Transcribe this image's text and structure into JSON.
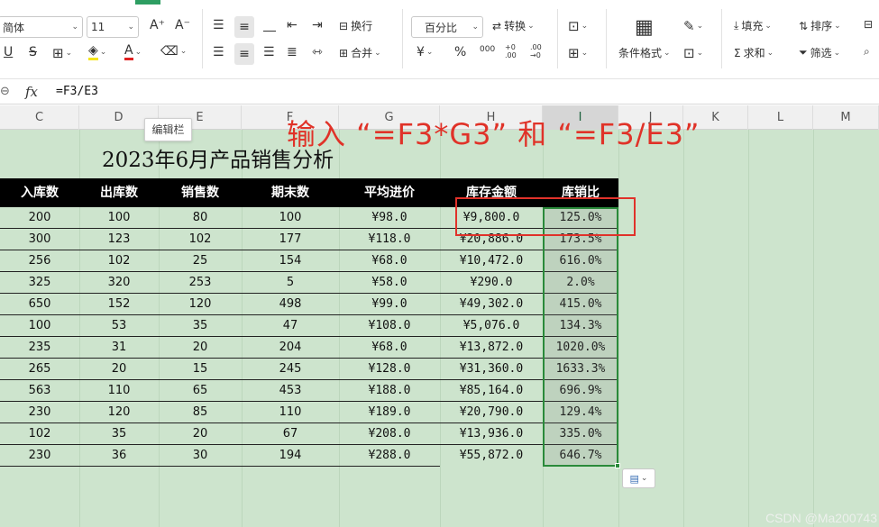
{
  "ribbon": {
    "font_name": "简体",
    "font_size": "11",
    "number_format": "百分比",
    "wrap_label": "换行",
    "merge_label": "合并",
    "convert_label": "转换",
    "cond_format_label": "条件格式",
    "fill_label": "填充",
    "sort_label": "排序",
    "sum_label": "求和",
    "filter_label": "筛选",
    "currency_symbol": "¥",
    "percent_symbol": "%",
    "thousands_symbol": "000",
    "dec_increase": "+0 .00",
    "dec_decrease": ".00 →0",
    "bold_u": "U",
    "strike_s": "S",
    "font_grow": "A⁺",
    "font_shrink": "A⁻",
    "font_color_letter": "A"
  },
  "formula_bar": {
    "formula": "=F3/E3",
    "fx": "fx"
  },
  "columns": [
    "C",
    "D",
    "E",
    "F",
    "G",
    "H",
    "I",
    "J",
    "K",
    "L",
    "M"
  ],
  "tooltip": "编辑栏",
  "annotation": "输入  “=F3*G3” 和 “=F3/E3”",
  "sheet": {
    "title": "2023年6月产品销售分析",
    "headers": [
      "入库数",
      "出库数",
      "销售数",
      "期末数",
      "平均进价",
      "库存金额",
      "库销比"
    ],
    "rows": [
      [
        "200",
        "100",
        "80",
        "100",
        "¥98.0",
        "¥9,800.0",
        "125.0%"
      ],
      [
        "300",
        "123",
        "102",
        "177",
        "¥118.0",
        "¥20,886.0",
        "173.5%"
      ],
      [
        "256",
        "102",
        "25",
        "154",
        "¥68.0",
        "¥10,472.0",
        "616.0%"
      ],
      [
        "325",
        "320",
        "253",
        "5",
        "¥58.0",
        "¥290.0",
        "2.0%"
      ],
      [
        "650",
        "152",
        "120",
        "498",
        "¥99.0",
        "¥49,302.0",
        "415.0%"
      ],
      [
        "100",
        "53",
        "35",
        "47",
        "¥108.0",
        "¥5,076.0",
        "134.3%"
      ],
      [
        "235",
        "31",
        "20",
        "204",
        "¥68.0",
        "¥13,872.0",
        "1020.0%"
      ],
      [
        "265",
        "20",
        "15",
        "245",
        "¥128.0",
        "¥31,360.0",
        "1633.3%"
      ],
      [
        "563",
        "110",
        "65",
        "453",
        "¥188.0",
        "¥85,164.0",
        "696.9%"
      ],
      [
        "230",
        "120",
        "85",
        "110",
        "¥189.0",
        "¥20,790.0",
        "129.4%"
      ],
      [
        "102",
        "35",
        "20",
        "67",
        "¥208.0",
        "¥13,936.0",
        "335.0%"
      ],
      [
        "230",
        "36",
        "30",
        "194",
        "¥288.0",
        "¥55,872.0",
        "646.7%"
      ]
    ]
  },
  "watermark": "CSDN @Ma200743",
  "colors": {
    "accent": "#2e9e62",
    "annotation": "#e03228",
    "sheet_bg": "#cde4cd",
    "header_bg": "#000000"
  }
}
